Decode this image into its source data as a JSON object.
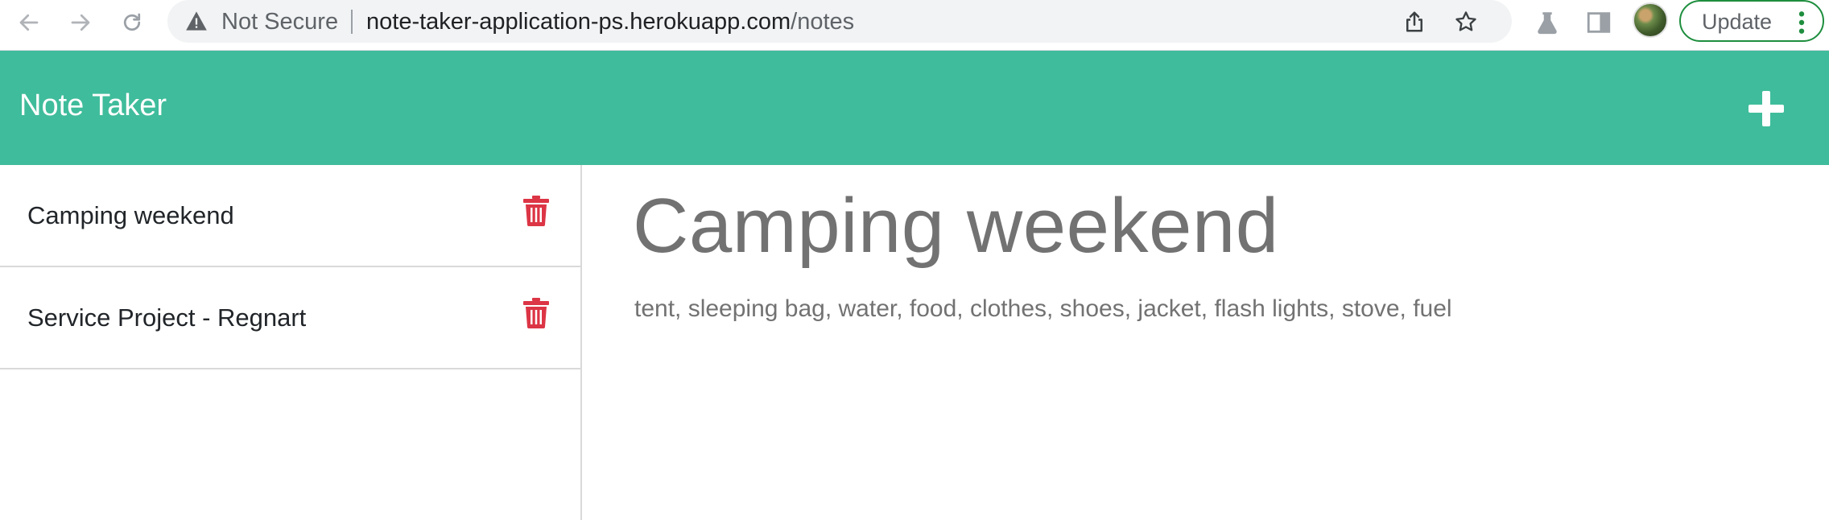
{
  "browser": {
    "security_label": "Not Secure",
    "url_host": "note-taker-application-ps.herokuapp.com",
    "url_path": "/notes",
    "update_label": "Update",
    "icons": {
      "back": "arrow-left-icon",
      "forward": "arrow-right-icon",
      "reload": "reload-icon",
      "security": "warning-triangle-icon",
      "share": "share-icon",
      "bookmark": "star-icon",
      "labs": "flask-icon",
      "side_panel": "side-panel-icon",
      "menu": "kebab-menu-icon"
    }
  },
  "app": {
    "brand": "Note Taker",
    "accent_color": "#3fbc9b",
    "delete_color": "#dc3545",
    "add_icon": "plus-icon",
    "notes": [
      {
        "title": "Camping weekend"
      },
      {
        "title": "Service Project - Regnart"
      }
    ],
    "active_note": {
      "title": "Camping weekend",
      "text": "tent, sleeping bag, water, food, clothes, shoes, jacket, flash lights, stove, fuel"
    }
  }
}
